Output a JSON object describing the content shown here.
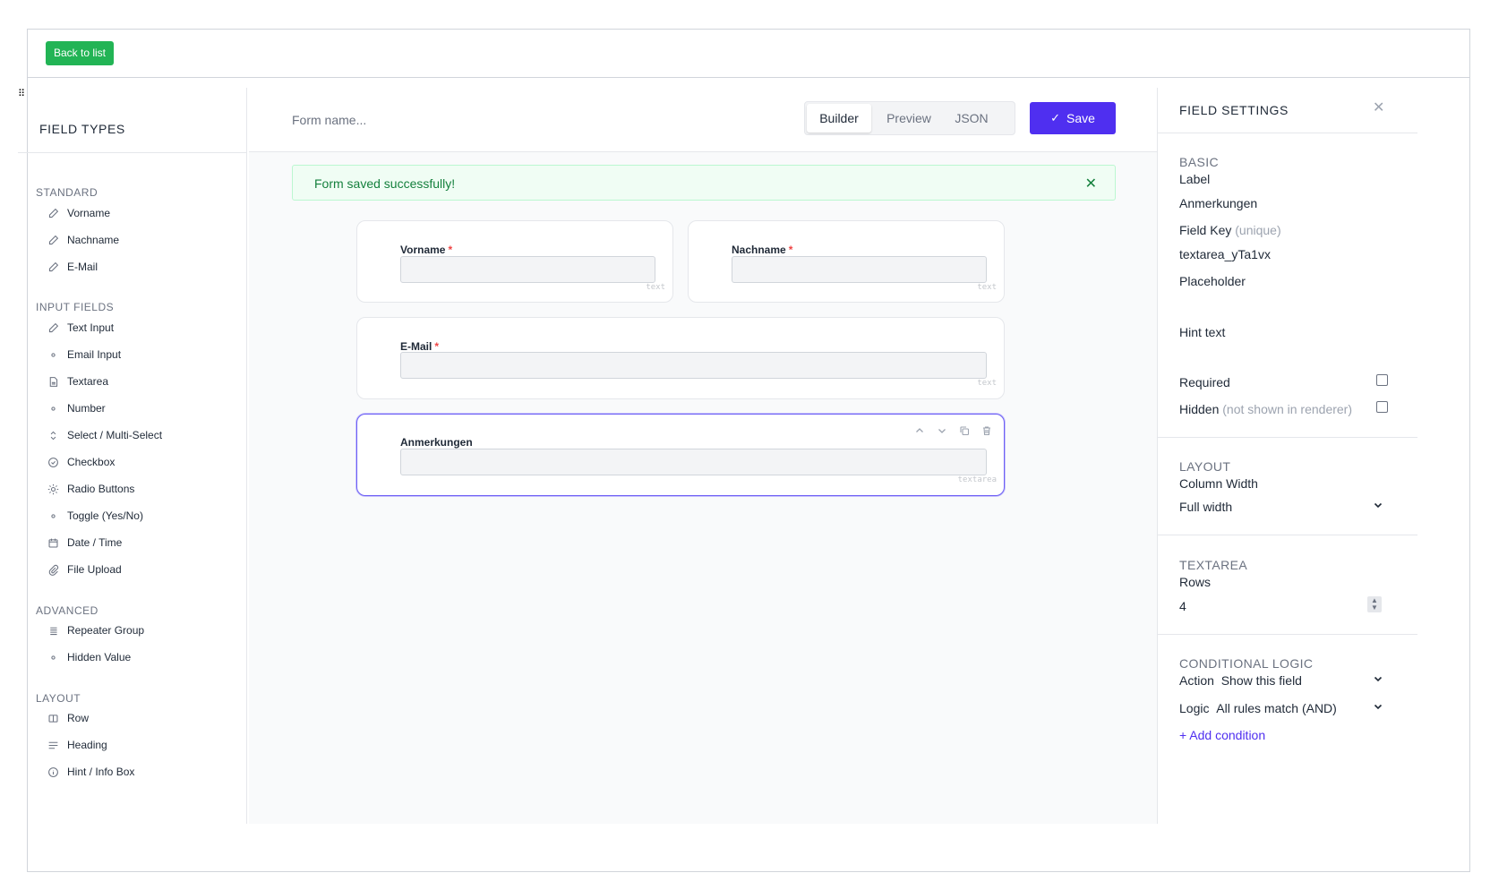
{
  "topbar": {
    "back_label": "Back to list"
  },
  "left": {
    "grip": "⠿",
    "title": "FIELD TYPES",
    "groups": [
      {
        "label": "STANDARD",
        "items": [
          {
            "label": "Vorname",
            "icon": "pencil-icon"
          },
          {
            "label": "Nachname",
            "icon": "pencil-icon"
          },
          {
            "label": "E-Mail",
            "icon": "pencil-icon"
          }
        ]
      },
      {
        "label": "INPUT FIELDS",
        "items": [
          {
            "label": "Text Input",
            "icon": "pencil-icon"
          },
          {
            "label": "Email Input",
            "icon": "dot-icon"
          },
          {
            "label": "Textarea",
            "icon": "document-icon"
          },
          {
            "label": "Number",
            "icon": "dot-icon"
          },
          {
            "label": "Select / Multi-Select",
            "icon": "chevron-updown-icon"
          },
          {
            "label": "Checkbox",
            "icon": "check-circle-icon"
          },
          {
            "label": "Radio Buttons",
            "icon": "sun-icon"
          },
          {
            "label": "Toggle (Yes/No)",
            "icon": "dot-icon"
          },
          {
            "label": "Date / Time",
            "icon": "calendar-icon"
          },
          {
            "label": "File Upload",
            "icon": "paperclip-icon"
          }
        ]
      },
      {
        "label": "ADVANCED",
        "items": [
          {
            "label": "Repeater Group",
            "icon": "list-icon"
          },
          {
            "label": "Hidden Value",
            "icon": "dot-icon"
          }
        ]
      },
      {
        "label": "LAYOUT",
        "items": [
          {
            "label": "Row",
            "icon": "columns-icon"
          },
          {
            "label": "Heading",
            "icon": "heading-icon"
          },
          {
            "label": "Hint / Info Box",
            "icon": "info-icon"
          }
        ]
      }
    ]
  },
  "center": {
    "form_name_placeholder": "Form name...",
    "tabs": [
      {
        "label": "Builder"
      },
      {
        "label": "Preview"
      },
      {
        "label": "JSON"
      }
    ],
    "save_check": "✓",
    "save_label": "Save",
    "alert": {
      "text": "Form saved successfully!",
      "close": "✕"
    },
    "required_mark": "*",
    "fields": [
      {
        "label": "Vorname",
        "type": "text"
      },
      {
        "label": "Nachname",
        "type": "text"
      },
      {
        "label": "E-Mail",
        "type": "text"
      },
      {
        "label": "Anmerkungen",
        "type": "textarea"
      }
    ]
  },
  "right": {
    "title": "FIELD SETTINGS",
    "close": "✕",
    "basic": {
      "section": "BASIC",
      "label_label": "Label",
      "label_value": "Anmerkungen",
      "key_label": "Field Key",
      "key_note": "(unique)",
      "key_value": "textarea_yTa1vx",
      "placeholder_label": "Placeholder",
      "hint_label": "Hint text",
      "required_label": "Required",
      "hidden_label": "Hidden",
      "hidden_note": "(not shown in renderer)"
    },
    "layout": {
      "section": "LAYOUT",
      "width_label": "Column Width",
      "width_value": "Full width"
    },
    "textarea": {
      "section": "TEXTAREA",
      "rows_label": "Rows",
      "rows_value": "4"
    },
    "conditional": {
      "section": "CONDITIONAL LOGIC",
      "action_label": "Action",
      "action_value": "Show this field",
      "logic_label": "Logic",
      "logic_value": "All rules match (AND)",
      "add_label": "+ Add condition"
    }
  }
}
